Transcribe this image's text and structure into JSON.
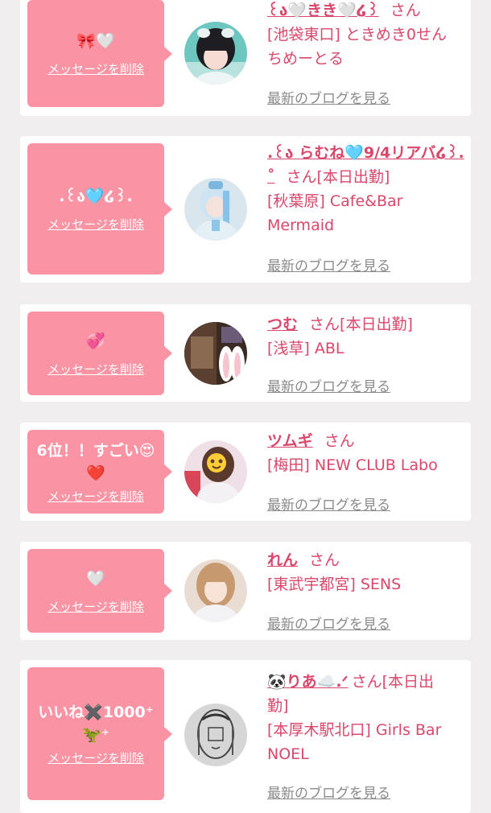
{
  "common": {
    "delete_label": "メッセージを削除",
    "blog_label": "最新のブログを見る",
    "san": "さん"
  },
  "colors": {
    "page_bg": "#f1eeef",
    "bubble_bg": "#fa94a4",
    "accent_text": "#d9476b",
    "link_gray": "#8a8a8a"
  },
  "items": [
    {
      "message": "🎀🤍",
      "name": "꒰ა🤍きき🤍໒꒱",
      "san": "さん",
      "status": "",
      "shop_line1": "[池袋東口] ときめき0せん",
      "shop_line2": "ちめーとる"
    },
    {
      "message": ".꒰ა🩵໒꒱.",
      "name": ".꒰ა らむね🩵9/4リアバ໒꒱.",
      "name_cont": "˚",
      "san": "さん",
      "status": "[本日出勤]",
      "shop_line1": "[秋葉原] Cafe&Bar",
      "shop_line2": "Mermaid"
    },
    {
      "message": "💞",
      "name": "つむ",
      "san": "さん",
      "status": "[本日出勤]",
      "shop_line1": "[浅草] ABL"
    },
    {
      "message_line1": "6位！！すごい😍",
      "message_line2": "❤️",
      "name": "ツムギ",
      "san": "さん",
      "status": "",
      "shop_line1": "[梅田] NEW CLUB Labo"
    },
    {
      "message": "🤍",
      "name": "れん",
      "san": "さん",
      "status": "",
      "shop_line1": "[東武宇都宮] SENS"
    },
    {
      "message_line1": "いいね✖️1000⁺",
      "message_line2": "🦖⁺",
      "name": "🐼りあ☁️.ᐟ",
      "san": "さん",
      "status_a": "[本日出",
      "status_b": "勤]",
      "shop_line1": "[本厚木駅北口] Girls Bar",
      "shop_line2": "NOEL"
    }
  ]
}
